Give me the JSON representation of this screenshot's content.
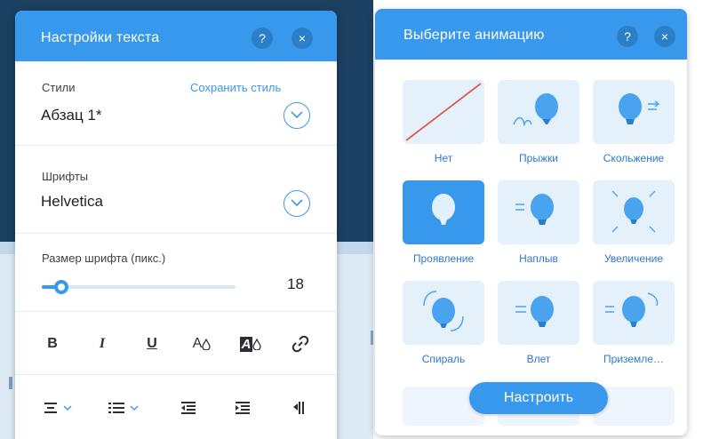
{
  "colors": {
    "accent": "#3899ec",
    "backdrop_dark": "#1b4060",
    "slash": "#e05a52"
  },
  "text_settings": {
    "title": "Настройки текста",
    "help_label": "?",
    "close_label": "×",
    "styles": {
      "label": "Стили",
      "save_link": "Сохранить стиль",
      "value": "Абзац 1*"
    },
    "fonts": {
      "label": "Шрифты",
      "value": "Helvetica"
    },
    "font_size": {
      "label": "Размер шрифта (пикс.)",
      "value": "18",
      "level": 0.1
    },
    "format_tools": {
      "bold": "B",
      "italic": "I",
      "underline": "U",
      "text_color": "A",
      "highlight": "A"
    }
  },
  "animation": {
    "title": "Выберите анимацию",
    "help_label": "?",
    "close_label": "×",
    "selected": "Проявление",
    "options": [
      {
        "label": "Нет",
        "icon": "none-slash-icon"
      },
      {
        "label": "Прыжки",
        "icon": "balloon-bounce-icon"
      },
      {
        "label": "Скольжение",
        "icon": "balloon-slide-icon"
      },
      {
        "label": "Проявление",
        "icon": "balloon-fade-icon"
      },
      {
        "label": "Наплыв",
        "icon": "balloon-float-icon"
      },
      {
        "label": "Увеличение",
        "icon": "balloon-expand-icon"
      },
      {
        "label": "Спираль",
        "icon": "balloon-spin-icon"
      },
      {
        "label": "Влет",
        "icon": "balloon-fly-in-icon"
      },
      {
        "label": "Приземле…",
        "icon": "balloon-land-icon"
      }
    ],
    "customize_button": "Настроить"
  }
}
